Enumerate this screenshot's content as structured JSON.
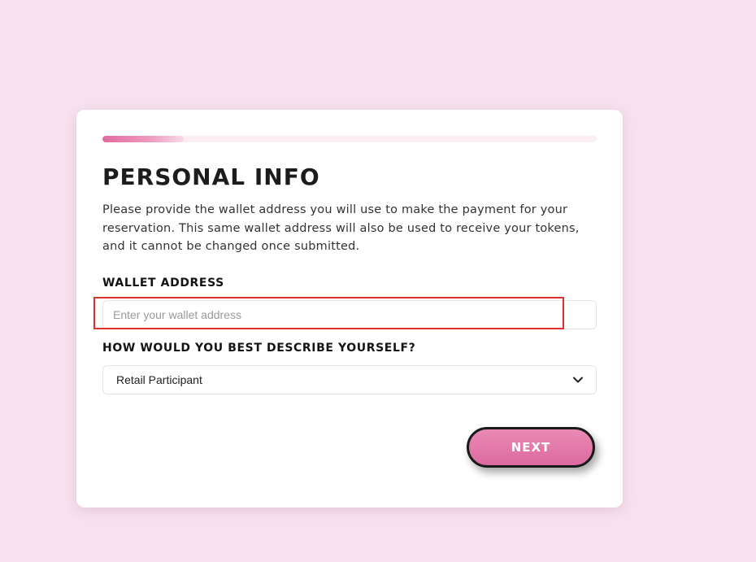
{
  "progress": {
    "fraction": 0.165
  },
  "form": {
    "title": "PERSONAL INFO",
    "description": "Please provide the wallet address you will use to make the payment for your reservation. This same wallet address will also be used to receive your tokens, and it cannot be changed once submitted.",
    "wallet": {
      "label": "WALLET ADDRESS",
      "value": "",
      "placeholder": "Enter your wallet address"
    },
    "describe": {
      "label": "HOW WOULD YOU BEST DESCRIBE YOURSELF?",
      "selected": "Retail Participant"
    },
    "next_label": "NEXT"
  },
  "colors": {
    "background": "#f7e1ee",
    "accent": "#e06aa0",
    "highlight": "#e0302a"
  },
  "icons": {
    "select_arrow": "chevron-down-icon"
  }
}
